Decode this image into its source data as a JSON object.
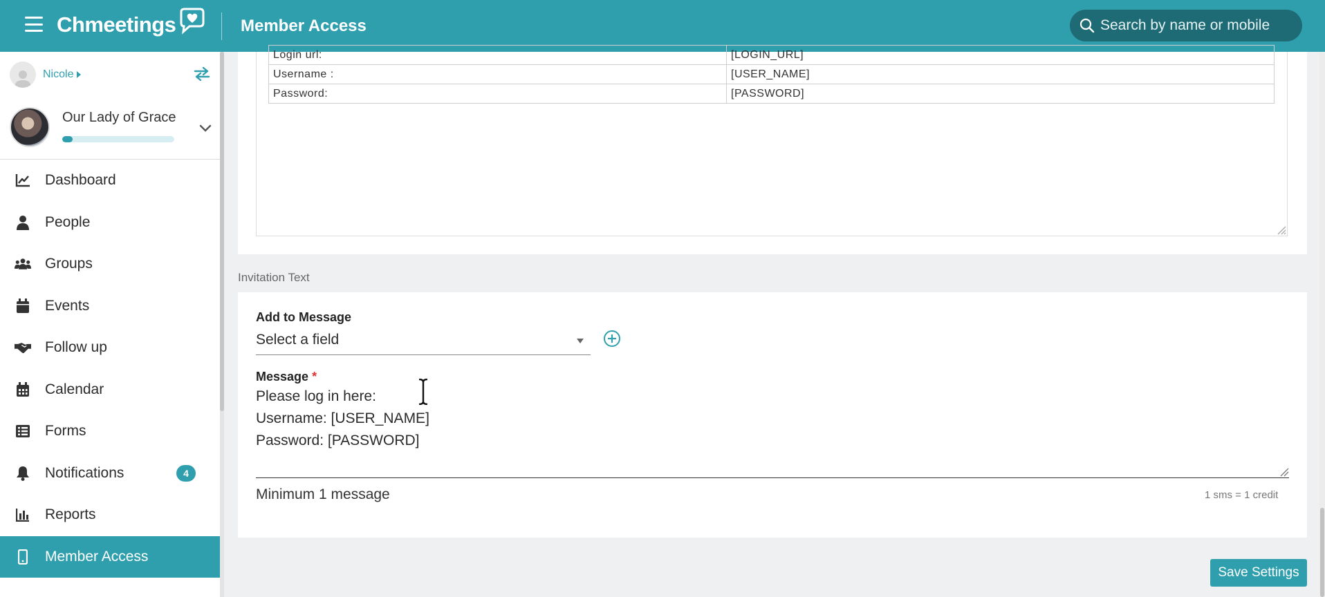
{
  "header": {
    "app_name": "Chmeetings",
    "page_title": "Member Access",
    "search_placeholder": "Search by name or mobile"
  },
  "sidebar": {
    "user_name": "Nicole",
    "church_name": "Our Lady of Grace",
    "church_progress_fraction": 0.09,
    "nav": [
      {
        "label": "Dashboard",
        "icon": "chart-line-icon"
      },
      {
        "label": "People",
        "icon": "person-icon"
      },
      {
        "label": "Groups",
        "icon": "users-icon"
      },
      {
        "label": "Events",
        "icon": "calendar-icon"
      },
      {
        "label": "Follow up",
        "icon": "handshake-icon"
      },
      {
        "label": "Calendar",
        "icon": "calendar-grid-icon"
      },
      {
        "label": "Forms",
        "icon": "list-icon"
      },
      {
        "label": "Notifications",
        "icon": "bell-icon",
        "badge": "4"
      },
      {
        "label": "Reports",
        "icon": "bar-chart-icon"
      },
      {
        "label": "Member Access",
        "icon": "mobile-icon",
        "active": true
      }
    ]
  },
  "editor_table": {
    "rows": [
      {
        "label": "Login url:",
        "value": "[LOGIN_URL]"
      },
      {
        "label": "Username :",
        "value": "[USER_NAME]"
      },
      {
        "label": "Password:",
        "value": "[PASSWORD]"
      }
    ]
  },
  "invitation": {
    "section_label": "Invitation Text",
    "add_to_message_label": "Add to Message",
    "select_value": "Select a field",
    "message_label": "Message",
    "required_mark": "*",
    "message_lines": [
      "Please log in here:",
      "Username: [USER_NAME]",
      "Password: [PASSWORD]"
    ],
    "min_note": "Minimum 1 message",
    "credit_note": "1 sms = 1 credit"
  },
  "actions": {
    "save_label": "Save Settings"
  },
  "colors": {
    "accent": "#2f9fae",
    "search_bg": "#1f6b75",
    "background": "#eef0f1"
  }
}
